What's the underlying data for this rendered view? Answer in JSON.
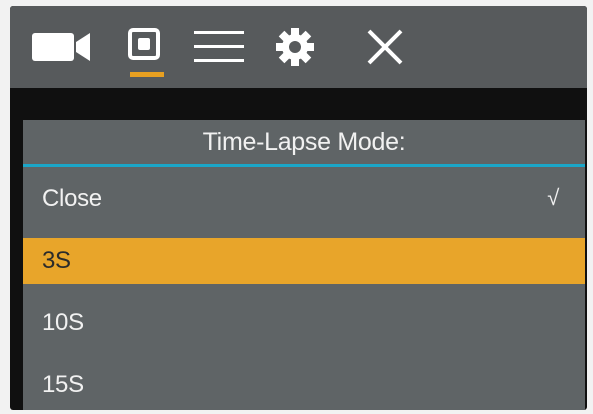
{
  "topbar": {
    "icons": [
      {
        "name": "video-camera-icon",
        "active": false
      },
      {
        "name": "photo-camera-icon",
        "active": true
      },
      {
        "name": "menu-icon",
        "active": false
      },
      {
        "name": "gear-icon",
        "active": false
      },
      {
        "name": "close-icon",
        "active": false
      }
    ],
    "active_color": "#e8a021"
  },
  "menu": {
    "title": "Time-Lapse Mode:",
    "options": [
      {
        "label": "Close",
        "checked": true,
        "highlighted": false
      },
      {
        "label": "3S",
        "checked": false,
        "highlighted": true
      },
      {
        "label": "10S",
        "checked": false,
        "highlighted": false
      },
      {
        "label": "15S",
        "checked": false,
        "highlighted": false
      }
    ],
    "check_mark": "√",
    "highlight_color": "#e8a52a",
    "divider_color": "#1ba6c8"
  }
}
